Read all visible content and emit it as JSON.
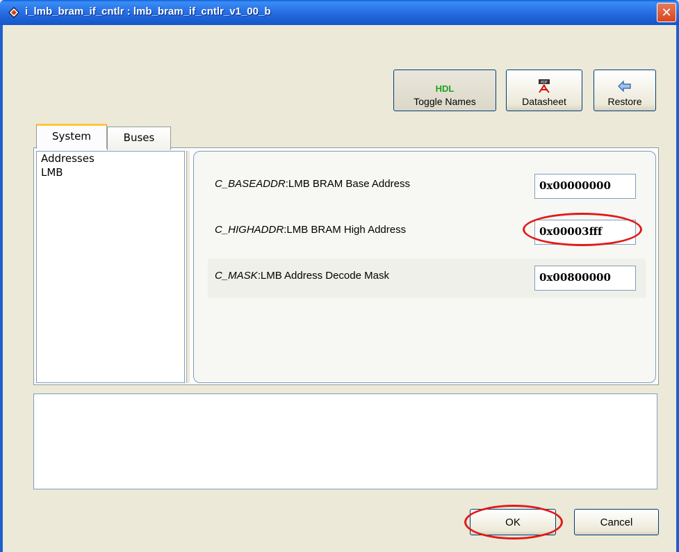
{
  "window": {
    "title": "i_lmb_bram_if_cntlr : lmb_bram_if_cntlr_v1_00_b",
    "close_glyph": "✕"
  },
  "toolbar": {
    "toggle_names": {
      "glyph": "HDL",
      "label": "Toggle Names",
      "icon": "hdl-icon"
    },
    "datasheet": {
      "label": "Datasheet",
      "icon": "pdf-icon"
    },
    "restore": {
      "label": "Restore",
      "icon": "restore-arrow-icon"
    }
  },
  "tabs": [
    {
      "label": "System",
      "active": true
    },
    {
      "label": "Buses",
      "active": false
    }
  ],
  "nav": {
    "items": [
      "Addresses",
      "LMB"
    ]
  },
  "params": [
    {
      "name": "C_BASEADDR",
      "desc": "LMB BRAM Base Address",
      "value": "0x00000000"
    },
    {
      "name": "C_HIGHADDR",
      "desc": "LMB BRAM High Address",
      "value": "0x00003fff"
    },
    {
      "name": "C_MASK",
      "desc": "LMB Address Decode Mask",
      "value": "0x00800000"
    }
  ],
  "buttons": {
    "ok": "OK",
    "cancel": "Cancel"
  },
  "colors": {
    "titlebar": "#1f63d6",
    "annotation": "#e01a1a",
    "hdl_green": "#20a020"
  }
}
